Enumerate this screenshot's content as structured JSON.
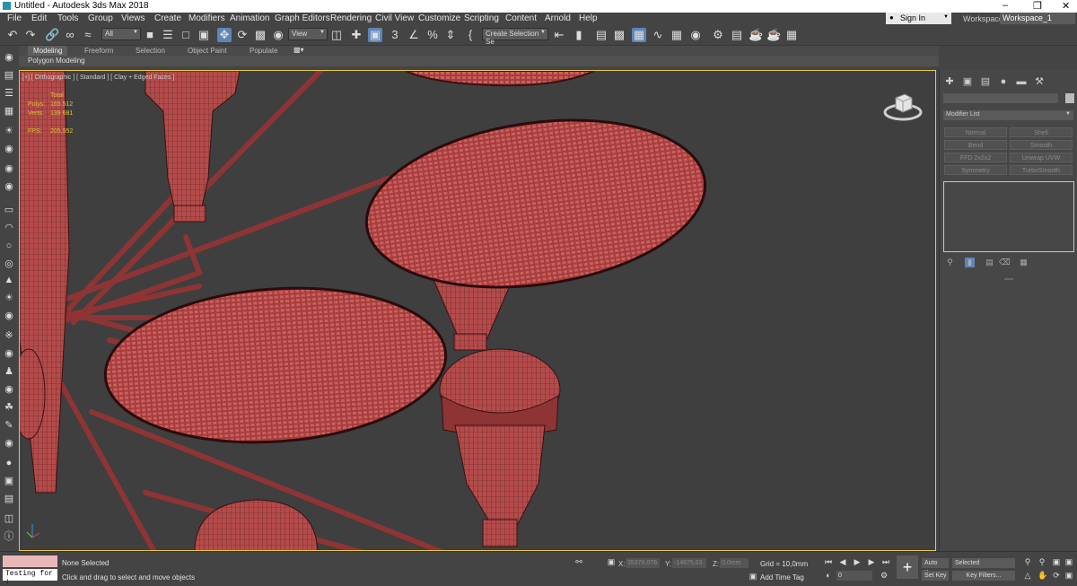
{
  "window": {
    "title": "Untitled - Autodesk 3ds Max 2018",
    "minimize": "–",
    "restore": "❐",
    "close": "✕"
  },
  "menu": [
    "File",
    "Edit",
    "Tools",
    "Group",
    "Views",
    "Create",
    "Modifiers",
    "Animation",
    "Graph Editors",
    "Rendering",
    "Civil View",
    "Customize",
    "Scripting",
    "Content",
    "Arnold",
    "Help"
  ],
  "account": {
    "sign_in": "Sign In",
    "workspaces_label": "Workspaces:",
    "workspace": "Workspace_1"
  },
  "toolbar": {
    "selection_filter": "All",
    "ref_coord": "View",
    "named_selection": "Create Selection Se",
    "snap_label": "3",
    "percent_snap": "%"
  },
  "ribbon": {
    "tabs": [
      "Modeling",
      "Freeform",
      "Selection",
      "Object Paint",
      "Populate"
    ],
    "active_tab": "Modeling",
    "panel_label": "Polygon Modeling"
  },
  "viewport": {
    "label": "[+] [ Orthographic ] [ Standard ] [ Clay + Edged Faces ]",
    "stats": {
      "total_label": "Total",
      "polys_label": "Polys:",
      "polys": "165 512",
      "verts_label": "Verts:",
      "verts": "139 681",
      "fps_label": "FPS:",
      "fps": "205,952"
    }
  },
  "command_panel": {
    "modifier_list": "Modifier List",
    "modifiers": [
      "Normal",
      "Shell",
      "Bend",
      "Smooth",
      "FFD 2x2x2",
      "Unwrap UVW",
      "Symmetry",
      "TurboSmooth"
    ]
  },
  "status": {
    "selection": "None Selected",
    "prompt": "Click and drag to select and move objects",
    "maxscript": "Testing for :",
    "x_label": "X:",
    "x": "35376,076",
    "y_label": "Y:",
    "y": "-14675,63",
    "z_label": "Z:",
    "z": "0,0mm",
    "grid": "Grid = 10,0mm",
    "add_time_tag": "Add Time Tag",
    "frame": "0",
    "auto_key": "Auto Key",
    "set_key": "Set Key",
    "key_mode": "Selected",
    "key_filters": "Key Filters..."
  },
  "colors": {
    "accent": "#5b86b8",
    "viewport_border": "#e7c84a",
    "mesh": "#b44b4b",
    "stats": "#e0c23a"
  }
}
